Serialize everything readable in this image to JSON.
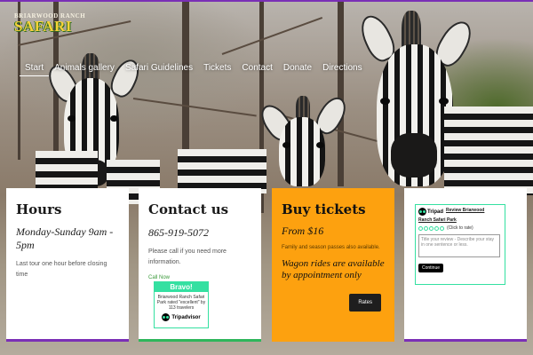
{
  "header": {
    "logo_top": "BRIARWOOD RANCH",
    "logo_main": "SAFARI"
  },
  "nav": {
    "items": [
      "Start",
      "Animals gallery",
      "Safari Guidelines",
      "Tickets",
      "Contact",
      "Donate",
      "Directions"
    ],
    "active": "Start"
  },
  "cards": {
    "hours": {
      "title": "Hours",
      "days": "Monday-Sunday 9am - 5pm",
      "note": "Last tour one hour before closing time",
      "bar_color": "#7a2fb6"
    },
    "contact": {
      "title": "Contact us",
      "phone": "865-919-5072",
      "note": "Please call if you need more information.",
      "link": "Call Now",
      "bar_color": "#2fb65b",
      "badge": {
        "head": "Bravo!",
        "text": "Briarwood Ranch Safari Park rated \"excellent\" by 113 travelers",
        "brand": "Tripadvisor"
      }
    },
    "tickets": {
      "title": "Buy tickets",
      "price": "From $16",
      "note": "Family and season passes also available.",
      "wagon": "Wagon rides are available by appointment only",
      "button": "Rates",
      "bg_color": "#fda10f"
    },
    "review": {
      "brand": "Tripad",
      "title": "Review Briarwood",
      "name": "Ranch Safari Park",
      "rate_hint": "(Click to rate)",
      "placeholder": "Title your review - Describe your stay in one sentence or less.",
      "button": "Continue",
      "bar_color": "#7a2fb6"
    }
  }
}
